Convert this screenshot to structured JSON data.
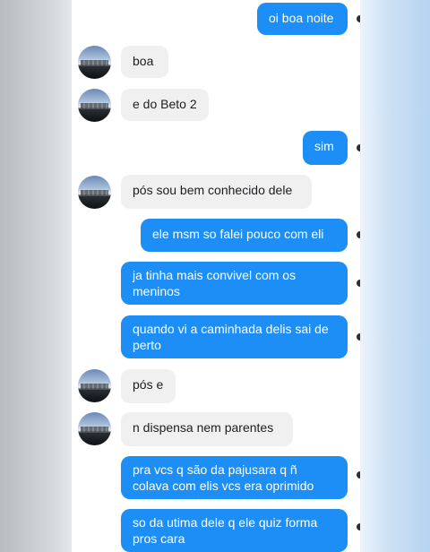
{
  "messages": [
    {
      "dir": "out",
      "text": "oi boa noite"
    },
    {
      "dir": "in",
      "text": "boa"
    },
    {
      "dir": "in",
      "text": "e do Beto 2"
    },
    {
      "dir": "out",
      "text": "sim"
    },
    {
      "dir": "in",
      "text": "pós sou bem conhecido dele"
    },
    {
      "dir": "out",
      "text": "ele msm so falei pouco com eli"
    },
    {
      "dir": "out",
      "text": "ja tinha mais convivel com os\nmeninos"
    },
    {
      "dir": "out",
      "text": "quando vi a caminhada delis sai de\nperto"
    },
    {
      "dir": "in",
      "text": "pós e"
    },
    {
      "dir": "in",
      "text": "n dispensa nem parentes"
    },
    {
      "dir": "out",
      "text": "pra vcs q são da pajusara q ñ\ncolava com elis vcs era oprimido"
    },
    {
      "dir": "out",
      "text": "so da utima dele q ele quiz forma\npros cara"
    }
  ],
  "colors": {
    "outgoing": "#1d8ef5",
    "incoming": "#f0f0f0"
  },
  "icons": {
    "avatar": "profile-photo-landscape",
    "read_receipt": "dark-dot"
  }
}
